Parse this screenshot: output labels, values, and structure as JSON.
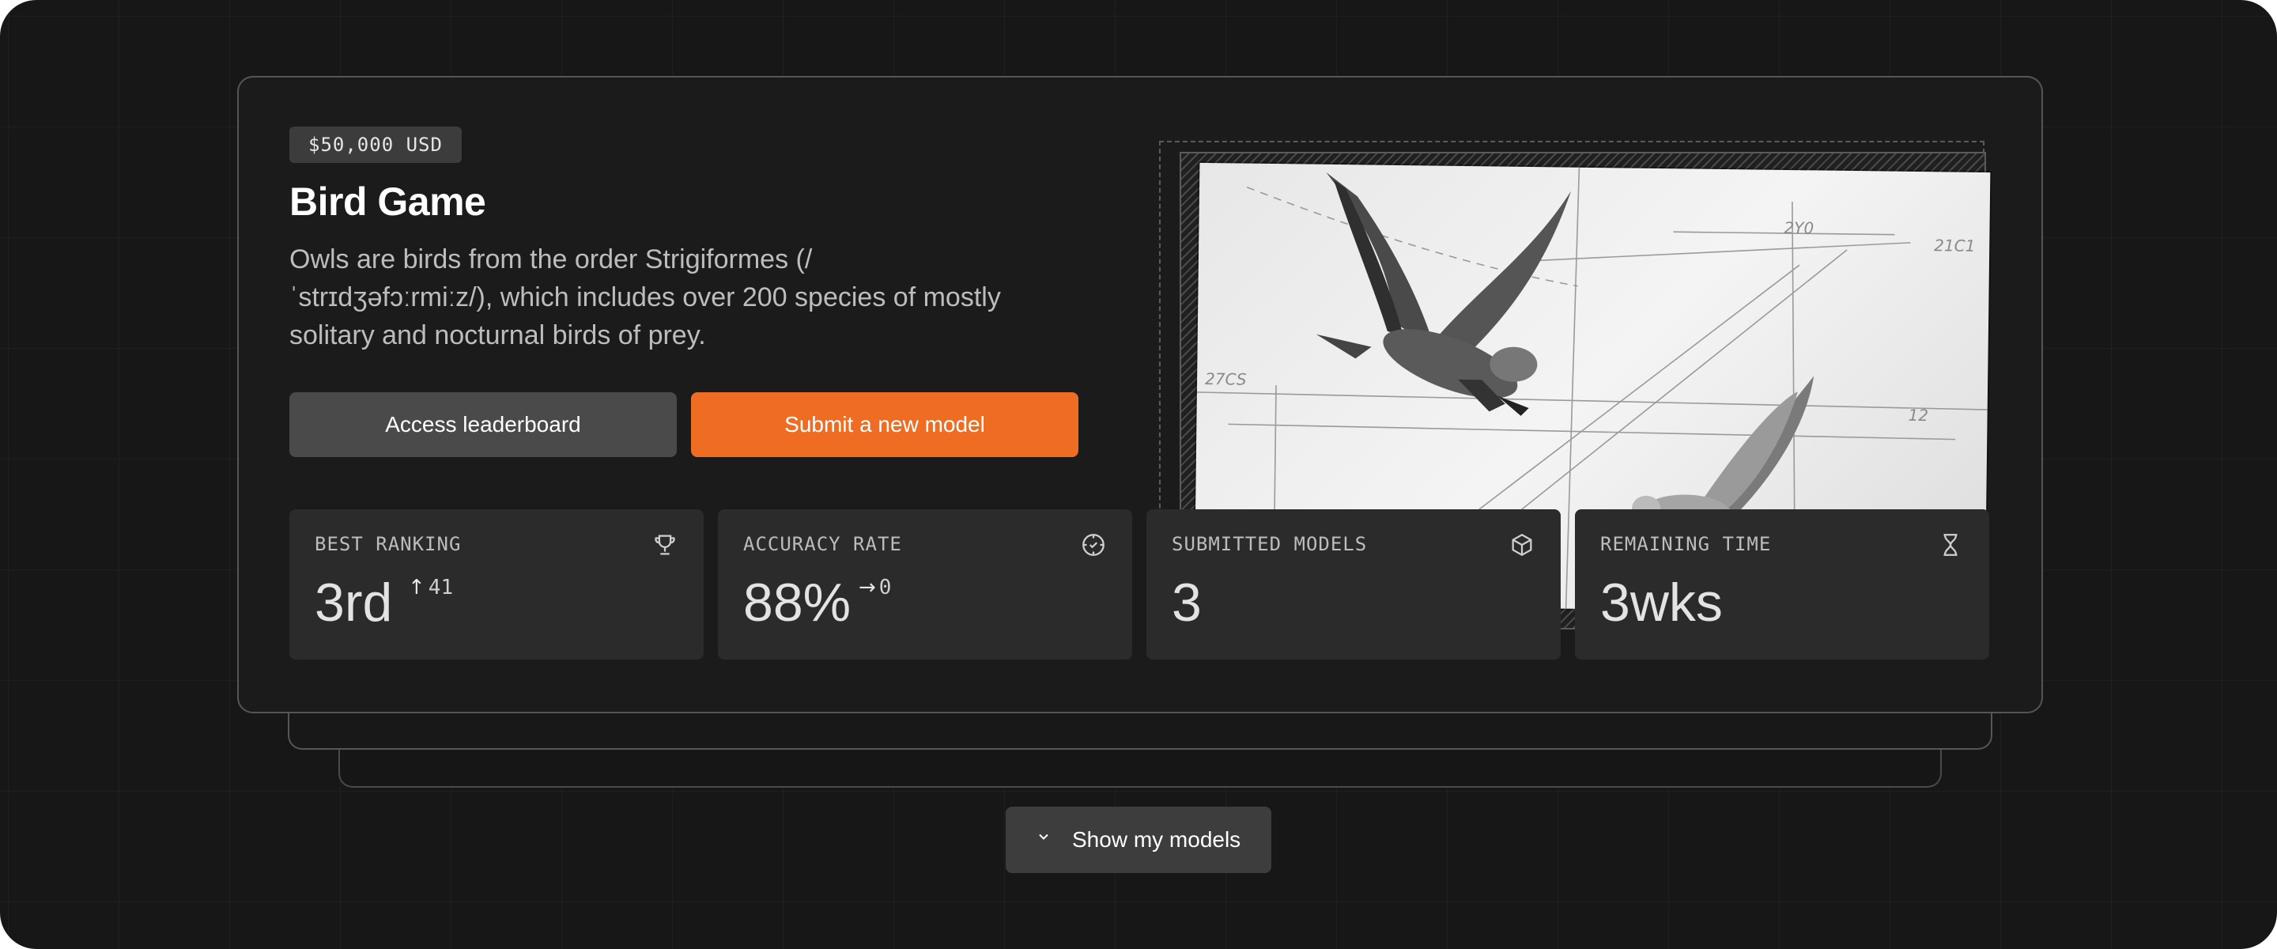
{
  "challenge": {
    "prize": "$50,000 USD",
    "title": "Bird Game",
    "description": "Owls are birds from the order Strigiformes (/ˈstrɪdʒəfɔːrmiːz/), which includes over 200 species of mostly solitary and nocturnal birds of prey.",
    "buttons": {
      "leaderboard": "Access leaderboard",
      "submit": "Submit a new model"
    },
    "accent_color": "#ef6c23"
  },
  "stats": [
    {
      "label": "BEST RANKING",
      "value": "3rd",
      "delta": "41",
      "delta_icon": "arrow-up-icon",
      "icon": "trophy-icon"
    },
    {
      "label": "ACCURACY RATE",
      "value": "88%",
      "delta": "0",
      "delta_icon": "arrow-right-icon",
      "icon": "target-icon"
    },
    {
      "label": "SUBMITTED MODELS",
      "value": "3",
      "icon": "cube-icon"
    },
    {
      "label": "REMAINING TIME",
      "value": "3wks",
      "icon": "hourglass-icon"
    }
  ],
  "footer": {
    "show_models": "Show my models"
  }
}
